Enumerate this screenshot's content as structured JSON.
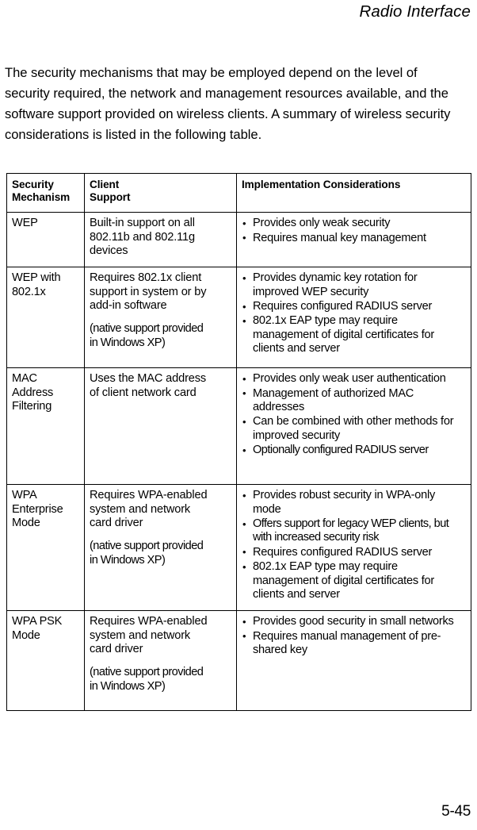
{
  "header": {
    "running_head": "Radio Interface"
  },
  "body": {
    "paragraph": "The security mechanisms that may be employed depend on the level of security required, the network and management resources available, and the software support provided on wireless clients. A summary of wireless security considerations is listed in the following table."
  },
  "table": {
    "columns": [
      {
        "line1": "Security",
        "line2": "Mechanism"
      },
      {
        "line1": "Client",
        "line2": "Support"
      },
      {
        "line1": "Implementation Considerations",
        "line2": ""
      }
    ],
    "rows": [
      {
        "mechanism": "WEP",
        "client_support": "Built-in support on all\n802.11b and 802.11g\ndevices",
        "client_native": "",
        "considerations": [
          "Provides only weak security",
          "Requires manual key management"
        ]
      },
      {
        "mechanism": "WEP with\n802.1x",
        "client_support": "Requires 802.1x client\nsupport in system or by\nadd-in software",
        "client_native": "(native support provided\nin Windows XP)",
        "considerations": [
          "Provides dynamic key rotation for improved WEP security",
          "Requires configured RADIUS server",
          "802.1x EAP type may require management of digital certificates for clients and server"
        ]
      },
      {
        "mechanism": "MAC Address\nFiltering",
        "client_support": "Uses the MAC address\nof client network card",
        "client_native": "",
        "considerations": [
          "Provides only weak user authentication",
          "Management of authorized MAC addresses",
          "Can be combined with other methods for improved security",
          "Optionally configured RADIUS server"
        ]
      },
      {
        "mechanism": "WPA\nEnterprise\nMode",
        "client_support": "Requires WPA-enabled\nsystem and network\ncard driver",
        "client_native": "(native support provided\nin Windows XP)",
        "considerations": [
          "Provides robust security in WPA-only mode",
          "Offers support for legacy WEP clients, but with increased security risk",
          "Requires configured RADIUS server",
          "802.1x EAP type may require management of digital certificates for clients and server"
        ]
      },
      {
        "mechanism": "WPA PSK\nMode",
        "client_support": "Requires WPA-enabled\nsystem and network\ncard driver",
        "client_native": "(native support provided\nin Windows XP)",
        "considerations": [
          "Provides good security in small networks",
          "Requires manual management of pre-shared key"
        ]
      }
    ]
  },
  "footer": {
    "page_number": "5-45"
  }
}
